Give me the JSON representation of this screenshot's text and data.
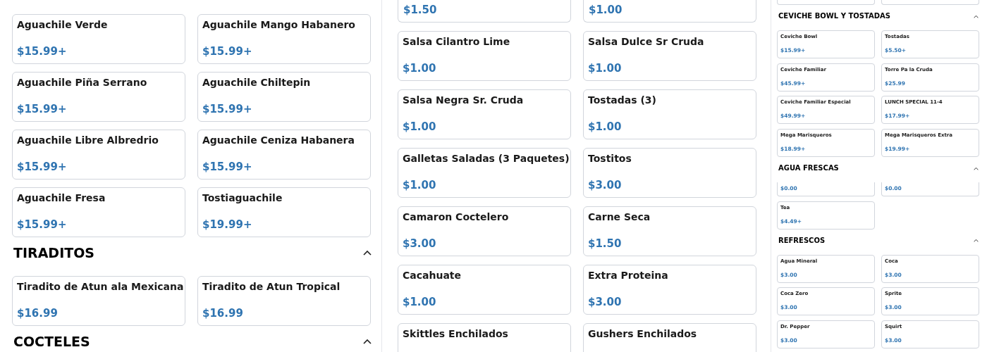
{
  "panels": [
    {
      "kind": "large",
      "sections": [
        {
          "items": [
            {
              "name": "Aguachile Verde",
              "price": "$15.99+"
            },
            {
              "name": "Aguachile Mango Habanero",
              "price": "$15.99+"
            },
            {
              "name": "Aguachile Piña Serrano",
              "price": "$15.99+"
            },
            {
              "name": "Aguachile Chiltepin",
              "price": "$15.99+"
            },
            {
              "name": "Aguachile Libre Albredrio",
              "price": "$15.99+"
            },
            {
              "name": "Aguachile Ceniza Habanera",
              "price": "$15.99+"
            },
            {
              "name": "Aguachile Fresa",
              "price": "$15.99+"
            },
            {
              "name": "Tostiaguachile",
              "price": "$19.99+"
            }
          ]
        },
        {
          "title": "TIRADITOS",
          "expanded": true,
          "items": [
            {
              "name": "Tiradito de Atun ala Mexicana",
              "price": "$16.99"
            },
            {
              "name": "Tiradito de Atun Tropical",
              "price": "$16.99"
            }
          ]
        },
        {
          "title": "COCTELES",
          "expanded": true
        }
      ]
    },
    {
      "kind": "large",
      "sections": [
        {
          "items": [
            {
              "price": "$1.50"
            },
            {
              "price": "$1.00"
            },
            {
              "name": "Salsa Cilantro Lime",
              "price": "$1.00"
            },
            {
              "name": "Salsa Dulce Sr Cruda",
              "price": "$1.00"
            },
            {
              "name": "Salsa Negra Sr. Cruda",
              "price": "$1.00"
            },
            {
              "name": "Tostadas (3)",
              "price": "$1.00"
            },
            {
              "name": "Galletas Saladas (3 Paquetes)",
              "price": "$1.00"
            },
            {
              "name": "Tostitos",
              "price": "$3.00"
            },
            {
              "name": "Camaron Coctelero",
              "price": "$3.00"
            },
            {
              "name": "Carne Seca",
              "price": "$1.50"
            },
            {
              "name": "Cacahuate",
              "price": "$1.00"
            },
            {
              "name": "Extra Proteina",
              "price": "$3.00"
            },
            {
              "name": "Skittles Enchilados"
            },
            {
              "name": "Gushers Enchilados"
            }
          ]
        }
      ]
    },
    {
      "kind": "small",
      "sections": [
        {
          "items": [
            {
              "kind": "clipped"
            },
            {
              "kind": "clipped"
            }
          ]
        },
        {
          "title": "CEVICHE BOWL Y TOSTADAS",
          "expanded": true,
          "items": [
            {
              "name": "Ceviche Bowl",
              "price": "$15.99+"
            },
            {
              "name": "Tostadas",
              "price": "$5.50+"
            },
            {
              "name": "Ceviche Familiar",
              "price": "$45.99+"
            },
            {
              "name": "Torre Pa la Cruda",
              "price": "$25.99"
            },
            {
              "name": "Ceviche Familiar Especial",
              "price": "$49.99+"
            },
            {
              "name": "LUNCH SPECIAL 11-4",
              "price": "$17.99+"
            },
            {
              "name": "Mega Marisqueros",
              "price": "$18.99+"
            },
            {
              "name": "Mega Marisqueros Extra",
              "price": "$19.99+"
            }
          ]
        },
        {
          "title": "AGUA FRESCAS",
          "expanded": true,
          "items": [
            {
              "price": "$0.00"
            },
            {
              "price": "$0.00"
            },
            {
              "name": "Tea",
              "price": "$4.49+"
            }
          ]
        },
        {
          "title": "REFRESCOS",
          "expanded": true,
          "items": [
            {
              "name": "Agua Mineral",
              "price": "$3.00"
            },
            {
              "name": "Coca",
              "price": "$3.00"
            },
            {
              "name": "Coca Zero",
              "price": "$3.00"
            },
            {
              "name": "Sprite",
              "price": "$3.00"
            },
            {
              "name": "Dr. Pepper",
              "price": "$3.00"
            },
            {
              "name": "Squirt",
              "price": "$3.00"
            }
          ]
        }
      ]
    }
  ]
}
